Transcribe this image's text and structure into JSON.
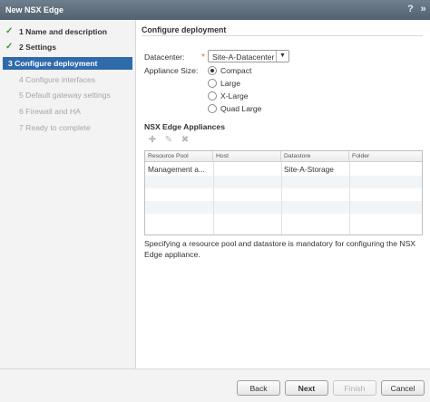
{
  "window": {
    "title": "New NSX Edge",
    "help_icon": "help-icon",
    "expand_icon": "expand-icon"
  },
  "steps": [
    {
      "label": "1  Name and description",
      "state": "done"
    },
    {
      "label": "2  Settings",
      "state": "done"
    },
    {
      "label": "3  Configure deployment",
      "state": "active"
    },
    {
      "label": "4  Configure interfaces",
      "state": "disabled"
    },
    {
      "label": "5  Default gateway settings",
      "state": "disabled"
    },
    {
      "label": "6  Firewall and HA",
      "state": "disabled"
    },
    {
      "label": "7  Ready to complete",
      "state": "disabled"
    }
  ],
  "main": {
    "section_title": "Configure deployment",
    "datacenter_label": "Datacenter:",
    "datacenter_value": "Site-A-Datacenter",
    "appliance_size_label": "Appliance Size:",
    "sizes": [
      {
        "label": "Compact",
        "selected": true
      },
      {
        "label": "Large",
        "selected": false
      },
      {
        "label": "X-Large",
        "selected": false
      },
      {
        "label": "Quad Large",
        "selected": false
      }
    ],
    "appliances_title": "NSX Edge Appliances",
    "table": {
      "columns": [
        "Resource Pool",
        "Host",
        "Datastore",
        "Folder"
      ],
      "rows": [
        [
          "Management a...",
          "",
          "Site-A-Storage",
          ""
        ]
      ]
    },
    "note": "Specifying a resource pool and datastore is mandatory for configuring the NSX Edge appliance."
  },
  "footer": {
    "back": "Back",
    "next": "Next",
    "finish": "Finish",
    "cancel": "Cancel"
  },
  "colors": {
    "active_step": "#2f6aab",
    "check": "#3e9a2e",
    "required": "#e06b1f"
  }
}
